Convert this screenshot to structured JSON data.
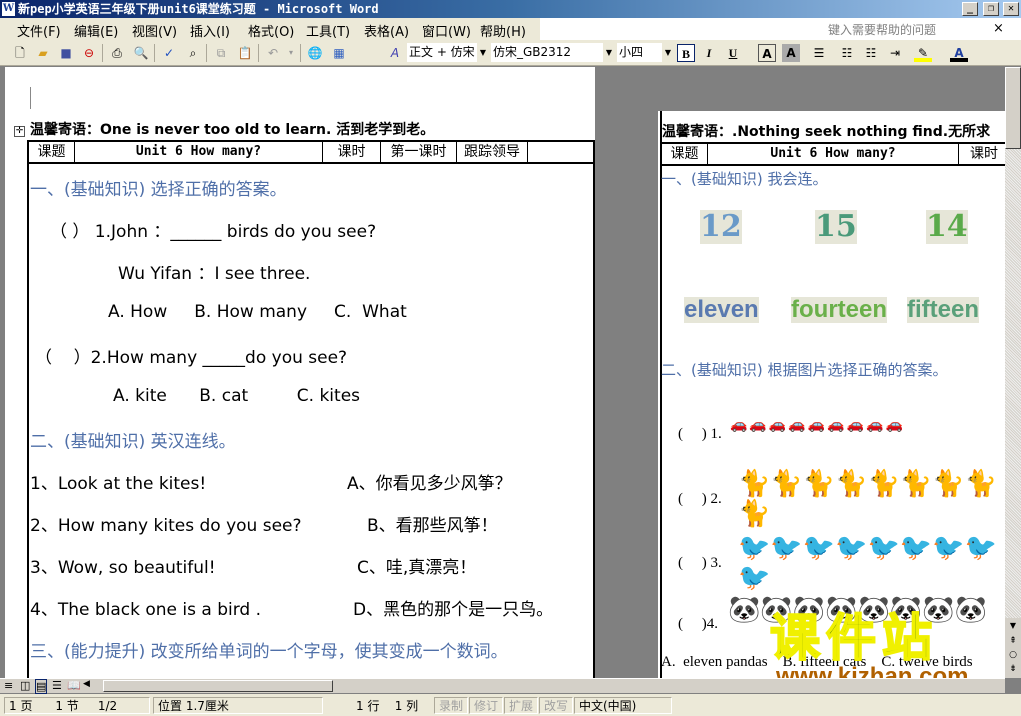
{
  "window": {
    "title": "新pep小学英语三年级下册unit6课堂练习题 - Microsoft Word",
    "minimize": "_",
    "restore": "❐",
    "close": "✕"
  },
  "menu": {
    "items": [
      "文件(F)",
      "编辑(E)",
      "视图(V)",
      "插入(I)",
      "格式(O)",
      "工具(T)",
      "表格(A)",
      "窗口(W)",
      "帮助(H)"
    ],
    "help_placeholder": "键入需要帮助的问题",
    "help_close": "×"
  },
  "toolbar": {
    "style": "正文 + 仿宋",
    "font": "仿宋_GB2312",
    "size": "小四",
    "bold": "B",
    "italic": "I",
    "underline": "U",
    "font_color": "#ff0000",
    "highlight_color": "#ffff00"
  },
  "left_page": {
    "motto": "温馨寄语：One is never too old to learn. 活到老学到老。",
    "header": [
      "课题",
      "Unit 6 How many?",
      "课时",
      "第一课时",
      "跟踪领导",
      ""
    ],
    "lines": [
      "一、(基础知识) 选择正确的答案。",
      "（  ） 1.John ：______  birds do you see?",
      "Wu Yifan ：I see three.",
      "A. How     B. How many     C.  What",
      "（    ）2.How many _____do you see?",
      "A. kite      B. cat         C. kites",
      "二、(基础知识) 英汉连线。",
      "1、Look at the kites!",
      "A、你看见多少风筝？",
      "2、How many kites do you see?",
      "B、看那些风筝！",
      "3、Wow, so beautiful!",
      "C、哇,真漂亮！",
      "4、The black one is a bird .",
      "D、黑色的那个是一只鸟。",
      "三、(能力提升) 改变所给单词的一个字母，使其变成一个数词。"
    ]
  },
  "right_page": {
    "motto": "温馨寄语：.Nothing seek nothing find.无所求",
    "header": [
      "课题",
      "Unit 6 How many?",
      "课时"
    ],
    "section1": "一、(基础知识) 我会连。",
    "numbers": [
      "12",
      "15",
      "14"
    ],
    "words": [
      "eleven",
      "fourteen",
      "fifteen"
    ],
    "section2": "二、(基础知识) 根据图片选择正确的答案。",
    "questions": [
      "(     ) 1.",
      "(     ) 2.",
      "(     ) 3.",
      "(     )4."
    ],
    "answers": "A.  eleven pandas    B. fifteen cats    C. twelve birds"
  },
  "watermark": {
    "text": "课件站",
    "url": "www.kjzhan.com"
  },
  "status": {
    "page": "1 页",
    "section": "1 节",
    "pages": "1/2",
    "position": "位置 1.7厘米",
    "line": "1 行",
    "col": "1 列",
    "rec": "录制",
    "trk": "修订",
    "ext": "扩展",
    "ovr": "改写",
    "lang": "中文(中国)"
  }
}
